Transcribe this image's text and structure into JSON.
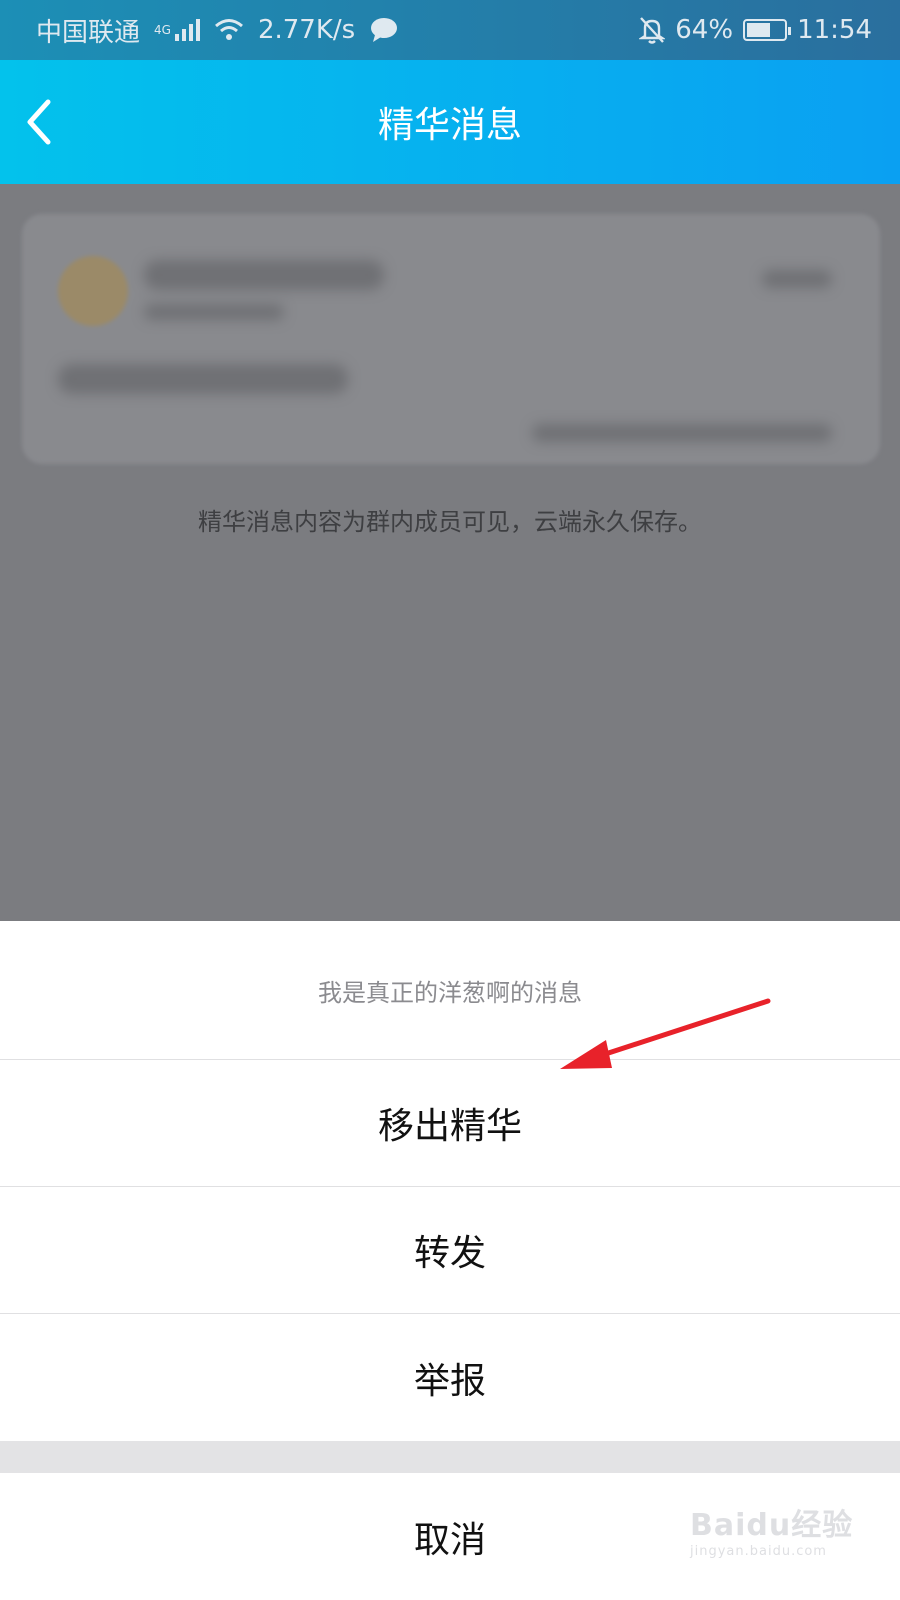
{
  "status_bar": {
    "carrier": "中国联通",
    "network": "4G",
    "speed": "2.77K/s",
    "battery": "64%",
    "battery_level": 0.64,
    "time": "11:54"
  },
  "header": {
    "title": "精华消息"
  },
  "content": {
    "hint": "精华消息内容为群内成员可见，云端永久保存。"
  },
  "action_sheet": {
    "title": "我是真正的洋葱啊的消息",
    "items": [
      "移出精华",
      "转发",
      "举报"
    ],
    "cancel": "取消"
  },
  "watermark": {
    "brand": "Baidu经验",
    "url": "jingyan.baidu.com"
  },
  "colors": {
    "header_start": "#03c2ec",
    "header_end": "#0aa0f2",
    "arrow": "#e8222a",
    "overlay": "#7b7c80"
  }
}
